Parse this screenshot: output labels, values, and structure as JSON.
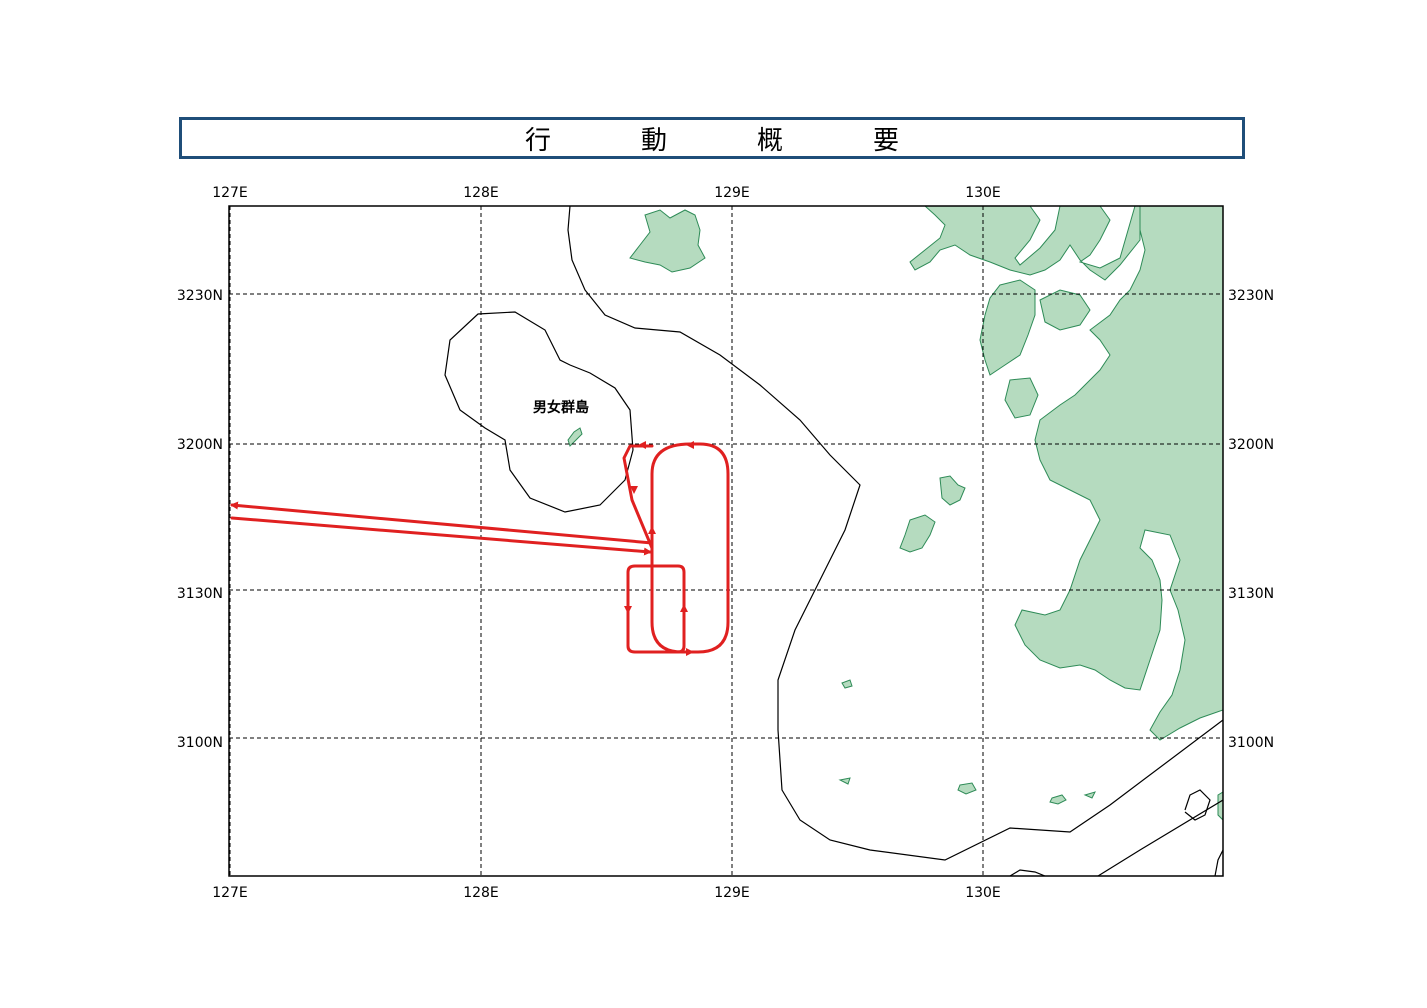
{
  "title": "行　動　概　要",
  "map": {
    "lon_range": [
      127.0,
      130.9667
    ],
    "lat_range": [
      30.6333,
      32.9333
    ],
    "lon_ticks": [
      {
        "value": 127,
        "label": "127E"
      },
      {
        "value": 128,
        "label": "128E"
      },
      {
        "value": 129,
        "label": "129E"
      },
      {
        "value": 130,
        "label": "130E"
      }
    ],
    "lat_ticks": [
      {
        "value": 32.5,
        "label": "3230N"
      },
      {
        "value": 32.0,
        "label": "3200N"
      },
      {
        "value": 31.5,
        "label": "3130N"
      },
      {
        "value": 31.0,
        "label": "3100N"
      }
    ],
    "grid": "dashed",
    "land_color": "#b5dbbf",
    "land_outline_color": "#2e8b57",
    "track_color": "#e02020",
    "boundary_color": "#000000"
  },
  "labels": {
    "danjo_islands": "男女群島"
  }
}
